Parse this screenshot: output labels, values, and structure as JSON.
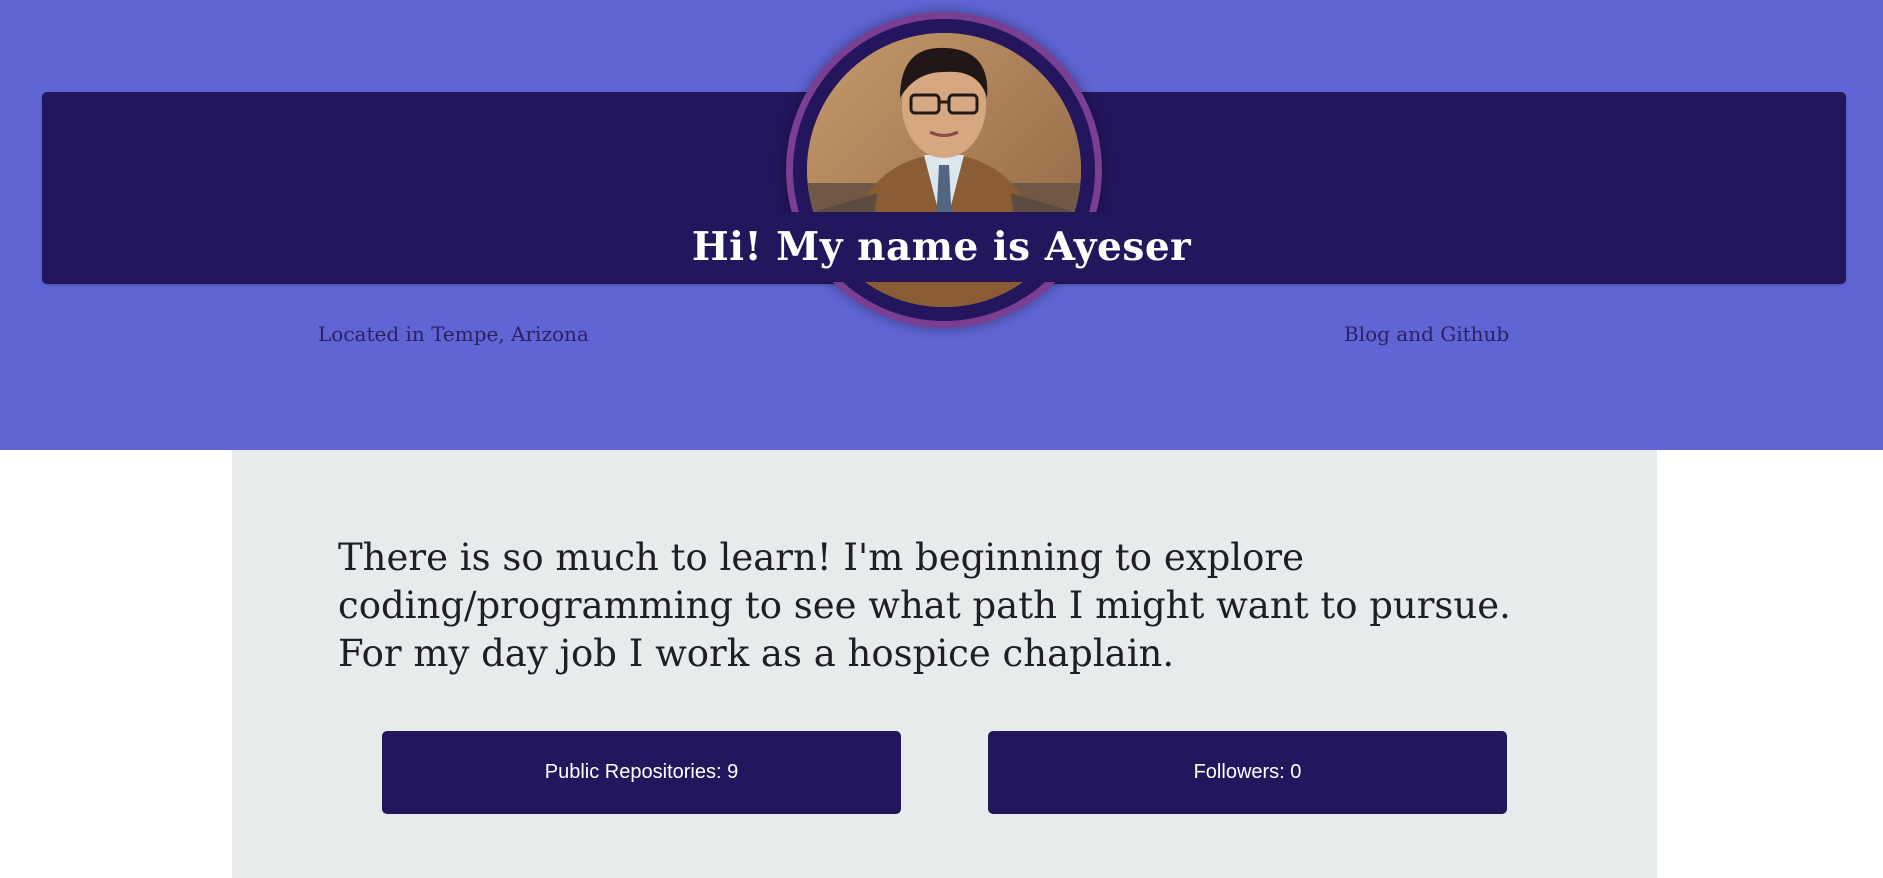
{
  "header": {
    "title": "Hi! My name is Ayeser",
    "location": "Located in Tempe, Arizona",
    "blog_link": "Blog and Github"
  },
  "avatar": {
    "description_icon": "profile-photo"
  },
  "main": {
    "bio": "There is so much to learn! I'm beginning to explore coding/programming to see what path I might want to pursue. For my day job I work as a hospice chaplain.",
    "stats": [
      {
        "label": "Public Repositories: 9"
      },
      {
        "label": "Followers: 0"
      }
    ]
  },
  "colors": {
    "header_background": "#5f65d4",
    "banner": "#24165c",
    "avatar_border": "#7a3f93",
    "content_background": "#e8ebec",
    "stat_button": "#24165c"
  }
}
